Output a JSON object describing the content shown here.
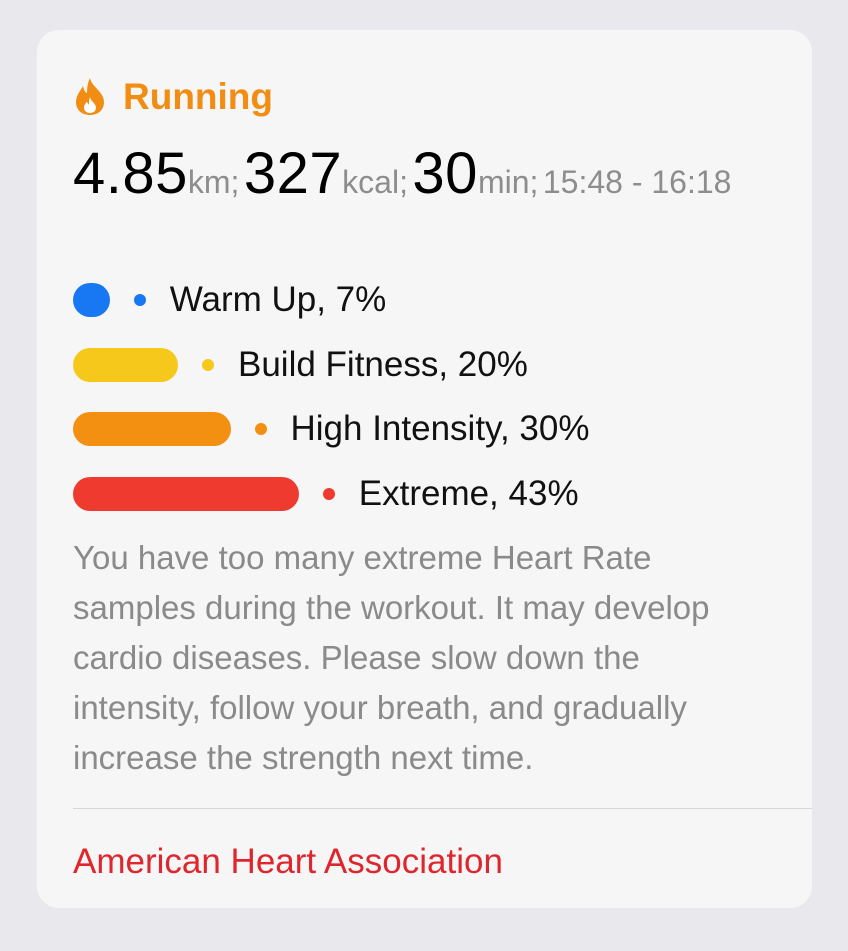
{
  "header": {
    "icon": "flame-icon",
    "title": "Running"
  },
  "summary": {
    "distance_value": "4.85",
    "distance_unit": "km;",
    "calories_value": "327",
    "calories_unit": "kcal;",
    "duration_value": "30",
    "duration_unit": "min;",
    "time_range": "15:48 - 16:18"
  },
  "zones": [
    {
      "label": "Warm Up, 7%",
      "percent": 7,
      "color": "#1877f2"
    },
    {
      "label": "Build Fitness, 20%",
      "percent": 20,
      "color": "#f6c81c"
    },
    {
      "label": "High Intensity, 30%",
      "percent": 30,
      "color": "#f38f11"
    },
    {
      "label": "Extreme, 43%",
      "percent": 43,
      "color": "#ef3a2f"
    }
  ],
  "message": "You have too many extreme Heart Rate samples during the workout. It may develop cardio diseases. Please slow down the intensity, follow your breath, and gradually increase the strength next time.",
  "source_link": "American Heart Association",
  "colors": {
    "accent": "#f08d12",
    "link": "#e0262d",
    "secondary_text": "#8a8a8a"
  }
}
